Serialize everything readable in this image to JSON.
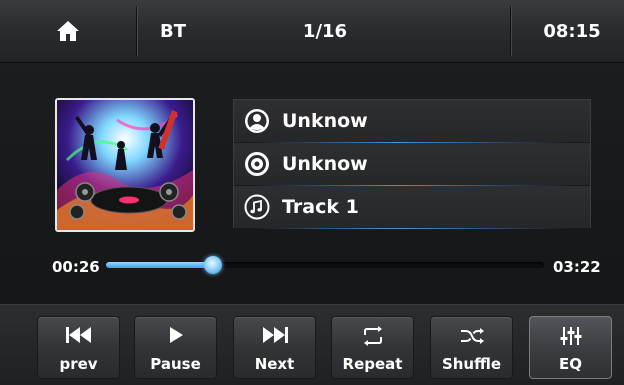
{
  "topbar": {
    "home_icon": "home-icon",
    "source": "BT",
    "track_count": "1/16",
    "clock": "08:15"
  },
  "now_playing": {
    "artist": "Unknow",
    "album": "Unknow",
    "title": "Track 1",
    "icons": [
      "artist-icon",
      "album-disc-icon",
      "music-note-icon"
    ]
  },
  "progress": {
    "elapsed": "00:26",
    "total": "03:22",
    "fraction": 0.245
  },
  "controls": [
    {
      "label": "prev",
      "icon": "skip-previous-icon"
    },
    {
      "label": "Pause",
      "icon": "play-icon"
    },
    {
      "label": "Next",
      "icon": "skip-next-icon"
    },
    {
      "label": "Repeat",
      "icon": "repeat-icon"
    },
    {
      "label": "Shuffle",
      "icon": "shuffle-icon"
    },
    {
      "label": "EQ",
      "icon": "equalizer-icon"
    }
  ],
  "colors": {
    "accent": "#3aa2e8",
    "text": "#ffffff",
    "background": "#1a1b1d"
  }
}
